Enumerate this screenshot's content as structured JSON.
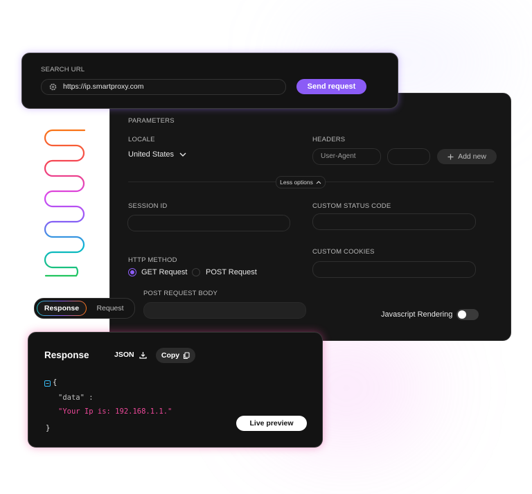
{
  "colors": {
    "accent": "#8b5cf6",
    "panel_bg": "#161616",
    "string_pink": "#ec4899"
  },
  "search": {
    "label": "SEARCH URL",
    "url": "https://ip.smartproxy.com",
    "send_label": "Send request"
  },
  "params": {
    "section_label": "PARAMETERS",
    "locale_label": "LOCALE",
    "locale_value": "United States",
    "headers_label": "HEADERS",
    "header_key_placeholder": "User-Agent",
    "add_new_label": "Add new",
    "less_options_label": "Less options",
    "session_id_label": "SESSION ID",
    "custom_status_label": "CUSTOM STATUS CODE",
    "custom_cookies_label": "CUSTOM COOKIES",
    "http_method_label": "HTTP METHOD",
    "get_label": "GET Request",
    "post_label": "POST Request",
    "post_body_label": "POST REQUEST BODY",
    "js_rendering_label": "Javascript Rendering"
  },
  "tabs": {
    "response": "Response",
    "request": "Request"
  },
  "response": {
    "title": "Response",
    "json_label": "JSON",
    "copy_label": "Copy",
    "code_open": "{",
    "code_key": "\"data\" :",
    "code_value": "\"Your Ip is: 192.168.1.1.\"",
    "code_close": "}",
    "live_preview_label": "Live preview"
  },
  "icons": [
    "settings-icon",
    "chevron-down-icon",
    "plus-icon",
    "chevron-up-icon",
    "download-icon",
    "copy-icon",
    "collapse-icon"
  ]
}
